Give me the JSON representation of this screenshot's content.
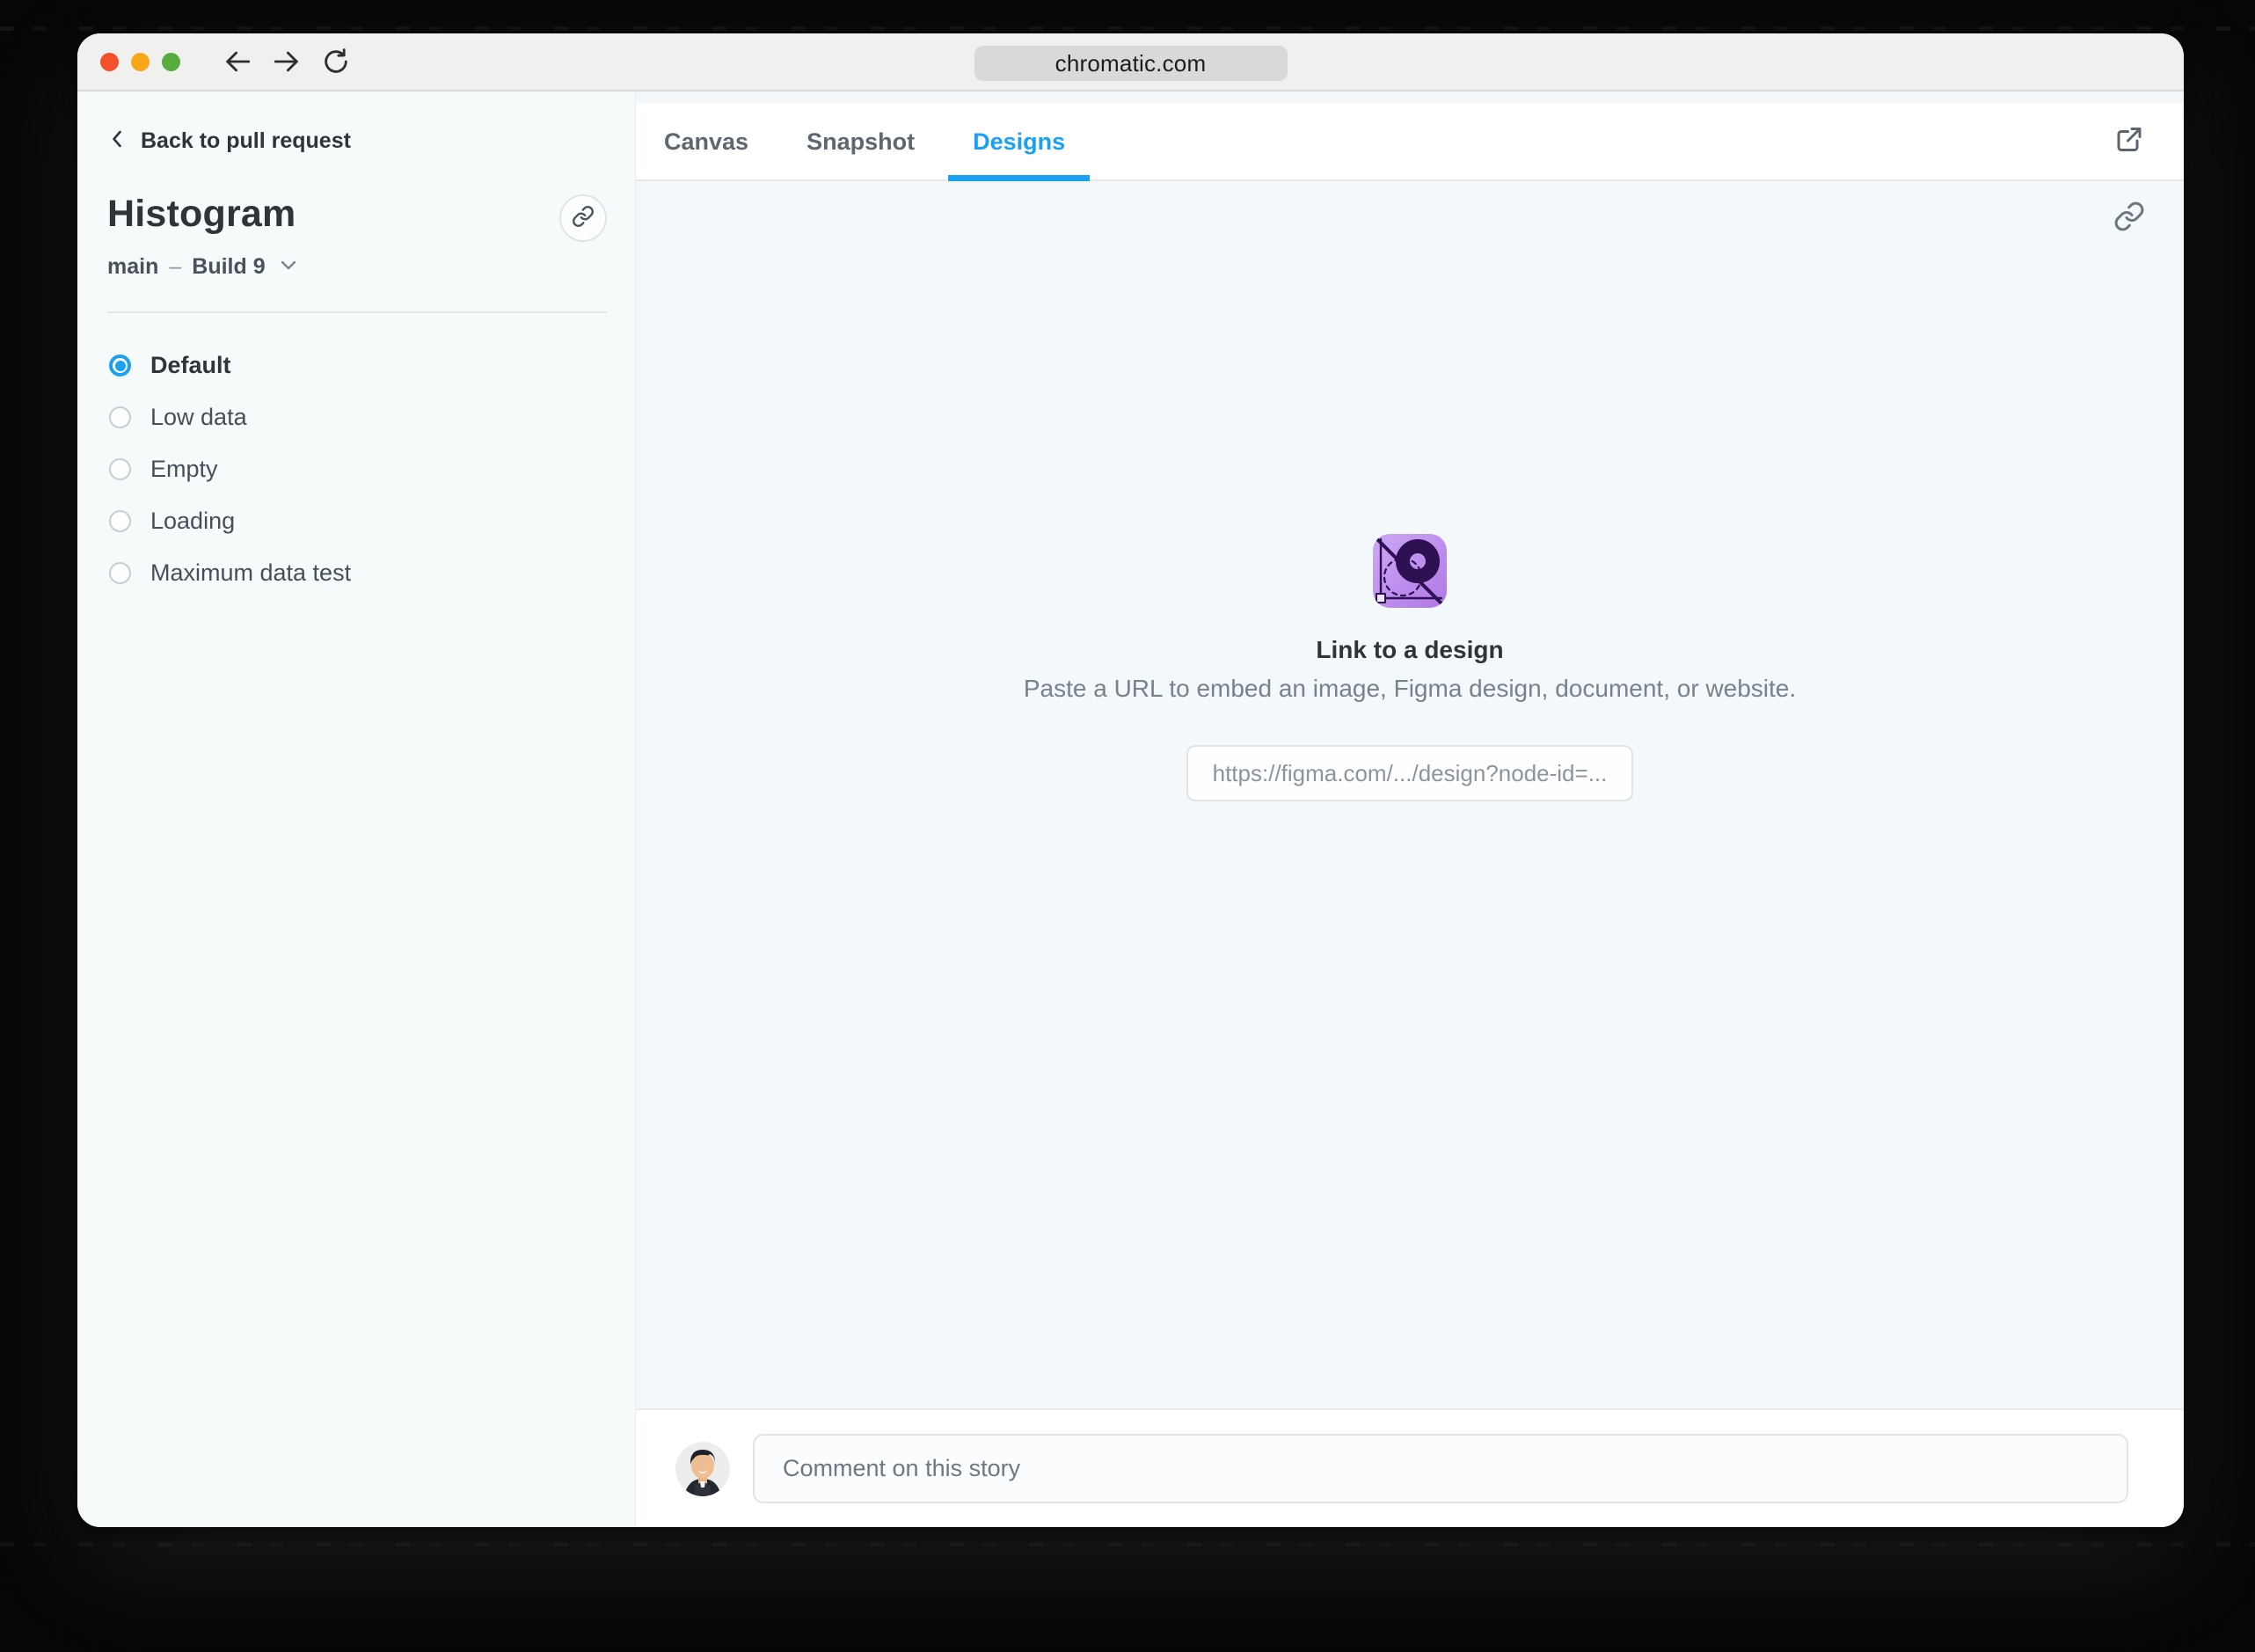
{
  "browser": {
    "url": "chromatic.com",
    "controls": [
      "close",
      "minimize",
      "zoom"
    ],
    "nav_icons": [
      "back-arrow",
      "forward-arrow",
      "reload"
    ]
  },
  "sidebar": {
    "back_label": "Back to pull request",
    "title": "Histogram",
    "branch": "main",
    "separator": "–",
    "build": "Build 9",
    "stories": [
      {
        "label": "Default",
        "selected": true
      },
      {
        "label": "Low data",
        "selected": false
      },
      {
        "label": "Empty",
        "selected": false
      },
      {
        "label": "Loading",
        "selected": false
      },
      {
        "label": "Maximum data test",
        "selected": false
      }
    ]
  },
  "tabs": [
    {
      "label": "Canvas",
      "active": false
    },
    {
      "label": "Snapshot",
      "active": false
    },
    {
      "label": "Designs",
      "active": true
    }
  ],
  "design_panel": {
    "heading": "Link to a design",
    "description": "Paste a URL to embed an image, Figma design, document, or website.",
    "url_placeholder": "https://figma.com/.../design?node-id=..."
  },
  "comment": {
    "placeholder": "Comment on this story"
  },
  "icons": {
    "sidebar_permalink": "link-icon",
    "panel_permalink": "link-icon",
    "tabbar_action": "external-link-icon",
    "design_empty": "design-tool-icon"
  },
  "colors": {
    "accent_blue": "#1CA0F2",
    "text_dark": "#2E3438",
    "text_grey": "#5C6770",
    "panel_bg": "#F3F8FB",
    "sidebar_bg": "#F7FAFA",
    "icon_purple_light": "#CBA6F3",
    "icon_purple_mid": "#B37EE8",
    "icon_purple_dark": "#2D1153",
    "traffic_red": "#F3502B",
    "traffic_yellow": "#F8A719",
    "traffic_green": "#57AC40"
  }
}
